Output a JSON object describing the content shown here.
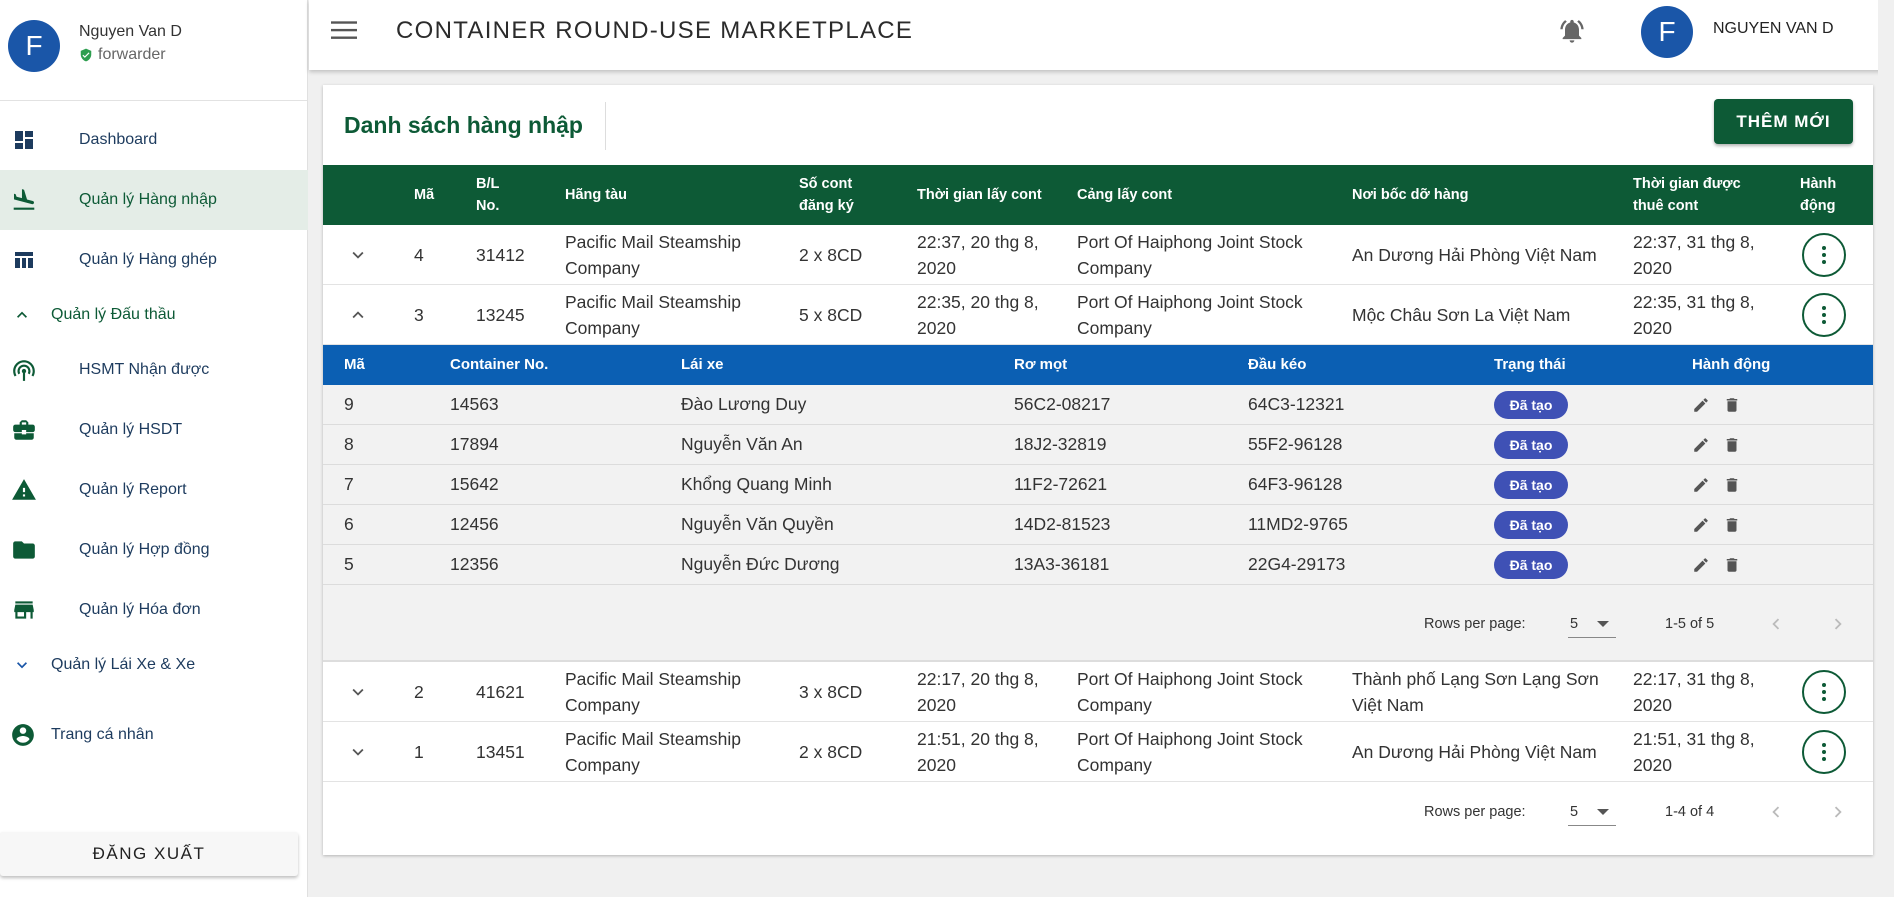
{
  "user": {
    "initial": "F",
    "name": "Nguyen Van D",
    "role": "forwarder"
  },
  "nav": {
    "dashboard": "Dashboard",
    "hang_nhap": "Quản lý Hàng nhập",
    "hang_ghep": "Quản lý Hàng ghép",
    "dau_thau": "Quản lý Đấu thầu",
    "hsmt": "HSMT Nhận được",
    "hsdt": "Quản lý HSDT",
    "report": "Quản lý Report",
    "hop_dong": "Quản lý Hợp đồng",
    "hoa_don": "Quản lý Hóa đơn",
    "lai_xe": "Quản lý Lái Xe & Xe",
    "ca_nhan": "Trang cá nhân",
    "logout": "ĐĂNG XUẤT"
  },
  "header": {
    "title": "CONTAINER ROUND-USE MARKETPLACE",
    "avatar_initial": "F",
    "user": "NGUYEN VAN D"
  },
  "page": {
    "title": "Danh sách hàng nhập",
    "add_button": "THÊM MỚI"
  },
  "table": {
    "headers": {
      "ma": "Mã",
      "bl_1": "B/L",
      "bl_2": "No.",
      "hang_tau": "Hãng tàu",
      "so_cont_1": "Số cont",
      "so_cont_2": "đăng ký",
      "tg_lay_cont": "Thời gian lấy cont",
      "cang_lay_cont": "Cảng lấy cont",
      "noi_boc": "Nơi bốc dỡ hàng",
      "tg_thue_1": "Thời gian được",
      "tg_thue_2": "thuê cont",
      "hanh_dong_1": "Hành",
      "hanh_dong_2": "động"
    },
    "rows": [
      {
        "ma": "4",
        "bl": "31412",
        "hang_tau_1": "Pacific Mail Steamship",
        "hang_tau_2": "Company",
        "so_cont": "2 x 8CD",
        "tg_lay_1": "22:37, 20 thg 8,",
        "tg_lay_2": "2020",
        "cang_1": "Port Of Haiphong Joint Stock",
        "cang_2": "Company",
        "noi_1": "An Dương Hải Phòng Việt Nam",
        "noi_2": "",
        "tg_thue_1": "22:37, 31 thg 8,",
        "tg_thue_2": "2020"
      },
      {
        "ma": "3",
        "bl": "13245",
        "hang_tau_1": "Pacific Mail Steamship",
        "hang_tau_2": "Company",
        "so_cont": "5 x 8CD",
        "tg_lay_1": "22:35, 20 thg 8,",
        "tg_lay_2": "2020",
        "cang_1": "Port Of Haiphong Joint Stock",
        "cang_2": "Company",
        "noi_1": "Mộc Châu Sơn La Việt Nam",
        "noi_2": "",
        "tg_thue_1": "22:35, 31 thg 8,",
        "tg_thue_2": "2020"
      },
      {
        "ma": "2",
        "bl": "41621",
        "hang_tau_1": "Pacific Mail Steamship",
        "hang_tau_2": "Company",
        "so_cont": "3 x 8CD",
        "tg_lay_1": "22:17, 20 thg 8,",
        "tg_lay_2": "2020",
        "cang_1": "Port Of Haiphong Joint Stock",
        "cang_2": "Company",
        "noi_1": "Thành phố Lạng Sơn Lạng Sơn",
        "noi_2": "Việt Nam",
        "tg_thue_1": "22:17, 31 thg 8,",
        "tg_thue_2": "2020"
      },
      {
        "ma": "1",
        "bl": "13451",
        "hang_tau_1": "Pacific Mail Steamship",
        "hang_tau_2": "Company",
        "so_cont": "2 x 8CD",
        "tg_lay_1": "21:51, 20 thg 8,",
        "tg_lay_2": "2020",
        "cang_1": "Port Of Haiphong Joint Stock",
        "cang_2": "Company",
        "noi_1": "An Dương Hải Phòng Việt Nam",
        "noi_2": "",
        "tg_thue_1": "21:51, 31 thg 8,",
        "tg_thue_2": "2020"
      }
    ],
    "pagination": {
      "rows_label": "Rows per page:",
      "per_page": "5",
      "range": "1-4 of 4"
    }
  },
  "subtable": {
    "headers": {
      "ma": "Mã",
      "container": "Container No.",
      "lai_xe": "Lái xe",
      "ro_mooc": "Rơ mọt",
      "dau_keo": "Đầu kéo",
      "trang_thai": "Trạng thái",
      "hanh_dong": "Hành động"
    },
    "rows": [
      {
        "ma": "9",
        "container": "14563",
        "lai_xe": "Đào Lương Duy",
        "ro_mooc": "56C2-08217",
        "dau_keo": "64C3-12321",
        "trang_thai": "Đã tạo"
      },
      {
        "ma": "8",
        "container": "17894",
        "lai_xe": "Nguyễn Văn An",
        "ro_mooc": "18J2-32819",
        "dau_keo": "55F2-96128",
        "trang_thai": "Đã tạo"
      },
      {
        "ma": "7",
        "container": "15642",
        "lai_xe": "Khổng Quang Minh",
        "ro_mooc": "11F2-72621",
        "dau_keo": "64F3-96128",
        "trang_thai": "Đã tạo"
      },
      {
        "ma": "6",
        "container": "12456",
        "lai_xe": "Nguyễn Văn Quyền",
        "ro_mooc": "14D2-81523",
        "dau_keo": "11MD2-9765",
        "trang_thai": "Đã tạo"
      },
      {
        "ma": "5",
        "container": "12356",
        "lai_xe": "Nguyễn Đức Dương",
        "ro_mooc": "13A3-36181",
        "dau_keo": "22G4-29173",
        "trang_thai": "Đã tạo"
      }
    ],
    "pagination": {
      "rows_label": "Rows per page:",
      "per_page": "5",
      "range": "1-5 of 5"
    }
  },
  "colors": {
    "primary_green": "#0d5a36",
    "sub_header_blue": "#0b5fb3",
    "chip_indigo": "#3f51b5",
    "avatar_blue": "#1a56a8",
    "active_nav_bg": "#e4ede7"
  }
}
